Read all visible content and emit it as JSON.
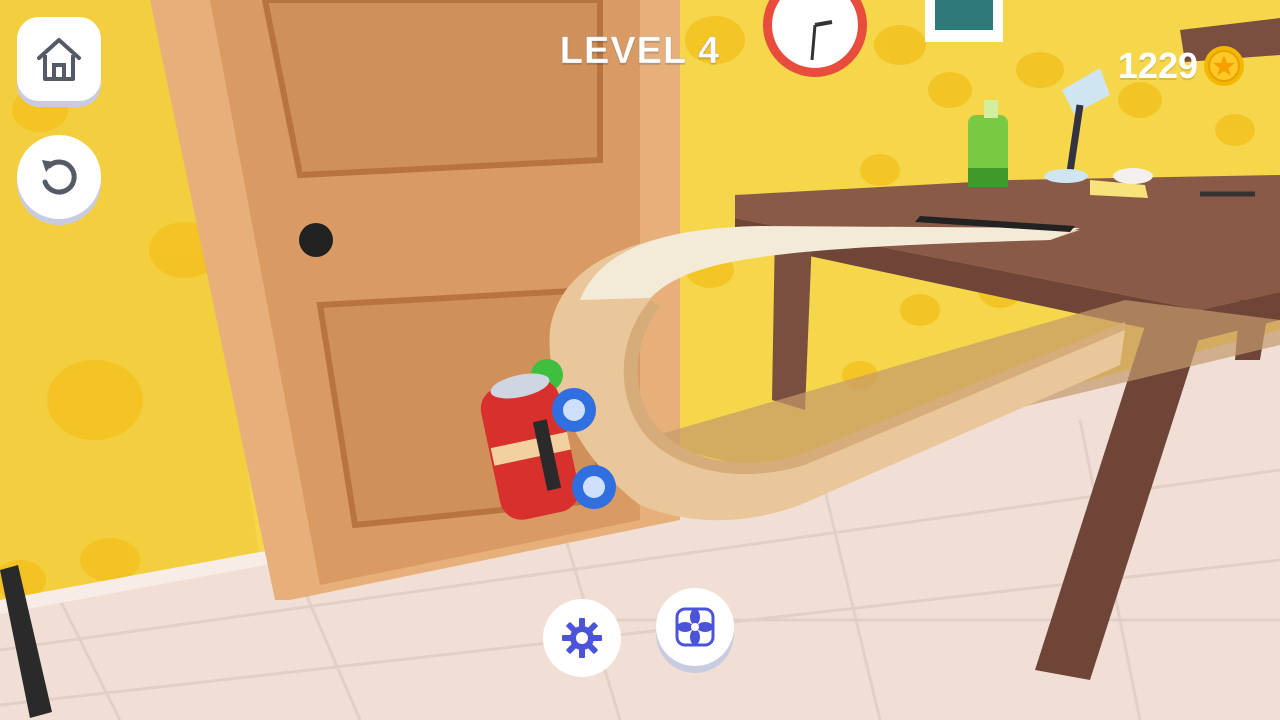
{
  "hud": {
    "level_label": "LEVEL 4",
    "coin_count": "1229"
  },
  "icons": {
    "home": "home-icon",
    "restart": "restart-icon",
    "coin": "star-coin-icon",
    "settings": "gear-icon",
    "fan": "fan-icon"
  },
  "colors": {
    "wall_yellow": "#f6d64a",
    "door_wood": "#d99a63",
    "floor_tile": "#f1dfd6",
    "table_wood": "#8a5a48",
    "cardboard": "#e9c79a",
    "can_red": "#d8302c",
    "button_icon_blue": "#4b54d8",
    "coin_gold": "#f5b800"
  }
}
